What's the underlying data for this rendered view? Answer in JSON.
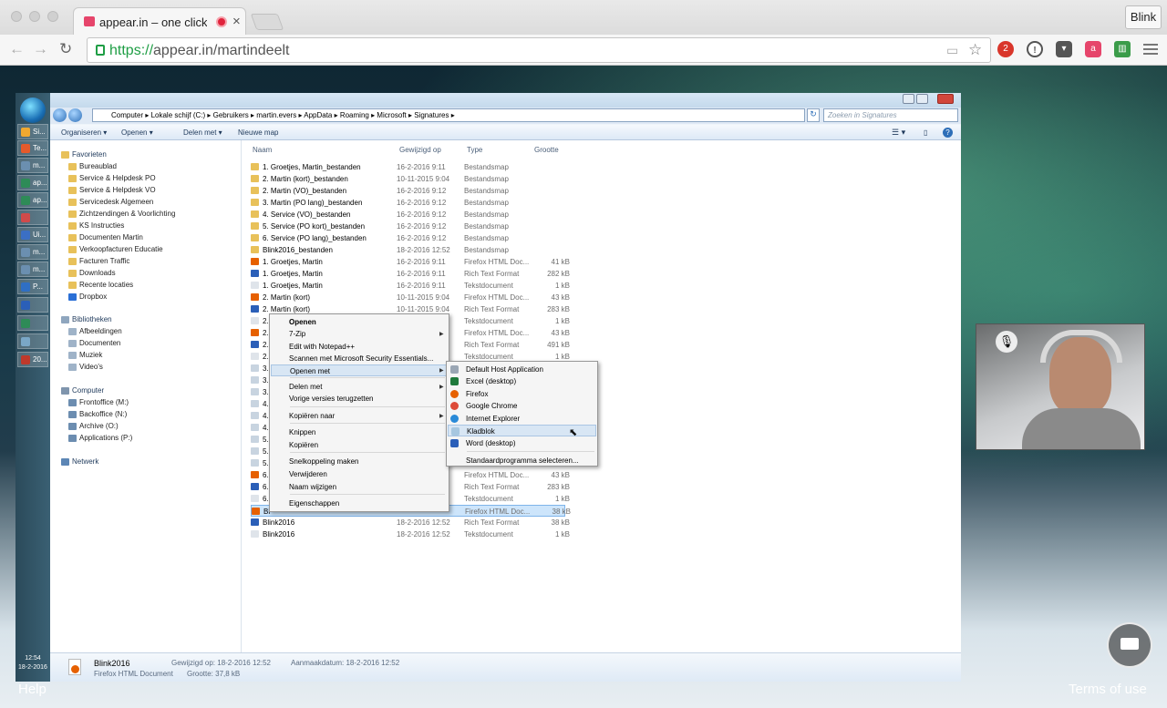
{
  "browser": {
    "tab_title": "appear.in – one click vid",
    "profile": "Blink",
    "url_scheme": "https://",
    "url_rest": "appear.in/martindeelt",
    "ext_badge": "2"
  },
  "explorer": {
    "breadcrumb": "Computer ▸ Lokale schijf (C:) ▸ Gebruikers ▸ martin.evers ▸ AppData ▸ Roaming ▸ Microsoft ▸ Signatures ▸",
    "search_placeholder": "Zoeken in Signatures",
    "cmd": {
      "organize": "Organiseren ▾",
      "open": "Openen ▾",
      "share": "Delen met ▾",
      "newfolder": "Nieuwe map"
    },
    "nav": {
      "favorites": "Favorieten",
      "fav_items": [
        "Bureaublad",
        "Service & Helpdesk PO",
        "Service & Helpdesk VO",
        "Servicedesk Algemeen",
        "Zichtzendingen & Voorlichting",
        "KS Instructies",
        "Documenten Martin",
        "Verkoopfacturen Educatie",
        "Facturen Traffic",
        "Downloads",
        "Recente locaties",
        "Dropbox"
      ],
      "libraries": "Bibliotheken",
      "lib_items": [
        "Afbeeldingen",
        "Documenten",
        "Muziek",
        "Video's"
      ],
      "computer": "Computer",
      "comp_items": [
        "Frontoffice (M:)",
        "Backoffice (N:)",
        "Archive (O:)",
        "Applications (P:)"
      ],
      "network": "Netwerk"
    },
    "headers": {
      "name": "Naam",
      "date": "Gewijzigd op",
      "type": "Type",
      "size": "Grootte"
    },
    "rows": [
      {
        "name": "1. Groetjes, Martin_bestanden",
        "date": "16-2-2016 9:11",
        "type": "Bestandsmap",
        "size": ""
      },
      {
        "name": "2. Martin (kort)_bestanden",
        "date": "10-11-2015 9:04",
        "type": "Bestandsmap",
        "size": ""
      },
      {
        "name": "2. Martin (VO)_bestanden",
        "date": "16-2-2016 9:12",
        "type": "Bestandsmap",
        "size": ""
      },
      {
        "name": "3. Martin (PO lang)_bestanden",
        "date": "16-2-2016 9:12",
        "type": "Bestandsmap",
        "size": ""
      },
      {
        "name": "4. Service (VO)_bestanden",
        "date": "16-2-2016 9:12",
        "type": "Bestandsmap",
        "size": ""
      },
      {
        "name": "5. Service (PO kort)_bestanden",
        "date": "16-2-2016 9:12",
        "type": "Bestandsmap",
        "size": ""
      },
      {
        "name": "6. Service (PO lang)_bestanden",
        "date": "16-2-2016 9:12",
        "type": "Bestandsmap",
        "size": ""
      },
      {
        "name": "Blink2016_bestanden",
        "date": "18-2-2016 12:52",
        "type": "Bestandsmap",
        "size": ""
      },
      {
        "name": "1. Groetjes, Martin",
        "date": "16-2-2016 9:11",
        "type": "Firefox HTML Doc...",
        "size": "41 kB"
      },
      {
        "name": "1. Groetjes, Martin",
        "date": "16-2-2016 9:11",
        "type": "Rich Text Format",
        "size": "282 kB"
      },
      {
        "name": "1. Groetjes, Martin",
        "date": "16-2-2016 9:11",
        "type": "Tekstdocument",
        "size": "1 kB"
      },
      {
        "name": "2. Martin (kort)",
        "date": "10-11-2015 9:04",
        "type": "Firefox HTML Doc...",
        "size": "43 kB"
      },
      {
        "name": "2. Martin (kort)",
        "date": "10-11-2015 9:04",
        "type": "Rich Text Format",
        "size": "283 kB"
      },
      {
        "name": "2.",
        "date": "",
        "type": "Tekstdocument",
        "size": "1 kB"
      },
      {
        "name": "2.",
        "date": "",
        "type": "Firefox HTML Doc...",
        "size": "43 kB"
      },
      {
        "name": "2.",
        "date": "",
        "type": "Rich Text Format",
        "size": "491 kB"
      },
      {
        "name": "2.",
        "date": "",
        "type": "Tekstdocument",
        "size": "1 kB"
      },
      {
        "name": "3.",
        "date": "",
        "type": "",
        "size": ""
      },
      {
        "name": "3.",
        "date": "",
        "type": "",
        "size": ""
      },
      {
        "name": "3.",
        "date": "",
        "type": "",
        "size": ""
      },
      {
        "name": "4.",
        "date": "",
        "type": "",
        "size": ""
      },
      {
        "name": "4.",
        "date": "",
        "type": "",
        "size": ""
      },
      {
        "name": "4.",
        "date": "",
        "type": "",
        "size": ""
      },
      {
        "name": "5.",
        "date": "",
        "type": "",
        "size": ""
      },
      {
        "name": "5.",
        "date": "",
        "type": "",
        "size": ""
      },
      {
        "name": "5.",
        "date": "",
        "type": "",
        "size": ""
      },
      {
        "name": "6.",
        "date": "",
        "type": "Firefox HTML Doc...",
        "size": "43 kB"
      },
      {
        "name": "6.",
        "date": "",
        "type": "Rich Text Format",
        "size": "283 kB"
      },
      {
        "name": "6.",
        "date": "",
        "type": "Tekstdocument",
        "size": "1 kB"
      },
      {
        "name": "Bl",
        "date": "",
        "type": "Firefox HTML Doc...",
        "size": "38 kB"
      },
      {
        "name": "Blink2016",
        "date": "18-2-2016 12:52",
        "type": "Rich Text Format",
        "size": "38 kB"
      },
      {
        "name": "Blink2016",
        "date": "18-2-2016 12:52",
        "type": "Tekstdocument",
        "size": "1 kB"
      }
    ],
    "status": {
      "name": "Blink2016",
      "kind": "Firefox HTML Document",
      "modified": "Gewijzigd op: 18-2-2016 12:52",
      "size": "Grootte: 37,8 kB",
      "created": "Aanmaakdatum: 18-2-2016 12:52"
    }
  },
  "context_menu": [
    "Openen",
    "7-Zip",
    "Edit with Notepad++",
    "Scannen met Microsoft Security Essentials...",
    "Openen met",
    "Delen met",
    "Vorige versies terugzetten",
    "Kopiëren naar",
    "Knippen",
    "Kopiëren",
    "Snelkoppeling maken",
    "Verwijderen",
    "Naam wijzigen",
    "Eigenschappen"
  ],
  "submenu": [
    "Default Host Application",
    "Excel (desktop)",
    "Firefox",
    "Google Chrome",
    "Internet Explorer",
    "Kladblok",
    "Word (desktop)",
    "Standaardprogramma selecteren..."
  ],
  "taskbar": {
    "items": [
      "Si...",
      "Te...",
      "m...",
      "ap...",
      "ap...",
      "",
      "Ui...",
      "m...",
      "m...",
      "P...",
      "",
      "",
      "",
      "20..."
    ],
    "time": "12:54",
    "date": "18-2-2016"
  },
  "page": {
    "help": "Help",
    "terms": "Terms of use"
  }
}
